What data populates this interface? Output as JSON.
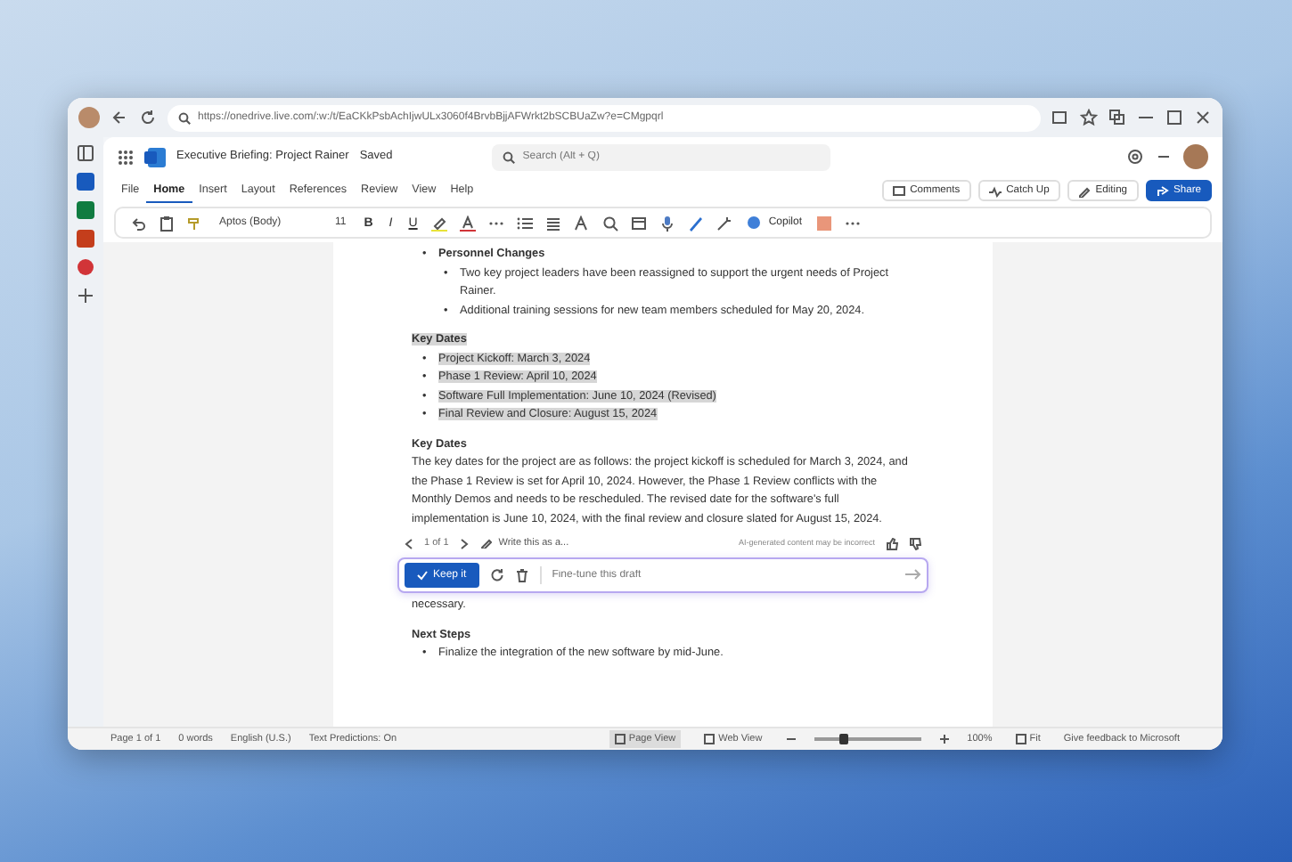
{
  "browser": {
    "url": "https://onedrive.live.com/:w:/t/EaCKkPsbAchIjwULx3060f4BrvbBjjAFWrkt2bSCBUaZw?e=CMgpqrl"
  },
  "app": {
    "title": "Executive Briefing: Project Rainer",
    "save_status": "Saved",
    "search": {
      "placeholder": "Search (Alt + Q)"
    }
  },
  "menu_tabs": [
    {
      "label": "File",
      "selected": false
    },
    {
      "label": "Home",
      "selected": true
    },
    {
      "label": "Insert",
      "selected": false
    },
    {
      "label": "Layout",
      "selected": false
    },
    {
      "label": "References",
      "selected": false
    },
    {
      "label": "Review",
      "selected": false
    },
    {
      "label": "View",
      "selected": false
    },
    {
      "label": "Help",
      "selected": false
    }
  ],
  "ribbon_actions": [
    {
      "label": "Comments",
      "kind": "comments"
    },
    {
      "label": "Catch Up",
      "kind": "catchup"
    },
    {
      "label": "Editing",
      "kind": "editing"
    },
    {
      "label": "Share",
      "kind": "share"
    }
  ],
  "toolbar": {
    "font": "Aptos (Body)",
    "size": "11",
    "bold": "B",
    "italic": "I",
    "underline": "U",
    "copilot": "Copilot"
  },
  "document": [
    {
      "kind": "list",
      "highlighted": false,
      "items": [
        {
          "marker": "•",
          "text": "Personnel Changes",
          "children": [
            {
              "marker": "•",
              "text": "Two key project leaders have been reassigned to support the urgent needs of Project Rainer."
            },
            {
              "marker": "•",
              "text": "Additional training sessions for new team members scheduled for May 20, 2024."
            }
          ]
        }
      ]
    },
    {
      "kind": "heading",
      "highlighted": true,
      "text": "Key Dates"
    },
    {
      "kind": "list",
      "highlighted": true,
      "items": [
        {
          "marker": "•",
          "text": "Project Kickoff: March 3, 2024"
        },
        {
          "marker": "•",
          "text": "Phase 1 Review: April 10, 2024"
        },
        {
          "marker": "•",
          "text": "Software Full Implementation: June 10, 2024 (Revised)"
        },
        {
          "marker": "•",
          "text": "Final Review and Closure: August 15, 2024"
        }
      ]
    },
    {
      "kind": "heading",
      "highlighted": false,
      "text": "Key Dates"
    },
    {
      "kind": "paragraph",
      "highlighted": false,
      "text": "The key dates for the project are as follows: the project kickoff is scheduled for March 3, 2024, and the Phase 1 Review is set for April 10, 2024. However, the Phase 1 Review conflicts with the Monthly Demos and needs to be rescheduled. The revised date for the software's full implementation is June 10, 2024, with the final review and closure slated for August 15, 2024."
    },
    {
      "kind": "copilot",
      "pager": "1 of 1",
      "prompt": "Write this as a...",
      "disclaimer": "AI-generated content may be incorrect",
      "keep": "Keep it",
      "input": {
        "placeholder": "Fine-tune this draft"
      }
    },
    {
      "kind": "paragraph",
      "highlighted": false,
      "text": "necessary."
    },
    {
      "kind": "heading",
      "highlighted": false,
      "text": "Next Steps"
    },
    {
      "kind": "list",
      "highlighted": false,
      "items": [
        {
          "marker": "•",
          "text": "Finalize the integration of the new software by mid-June."
        }
      ]
    }
  ],
  "status_bar": {
    "items": [
      "Page 1 of 1",
      "0 words",
      "English (U.S.)",
      "Text Predictions: On"
    ],
    "views": [
      {
        "label": "Page View",
        "selected": true
      },
      {
        "label": "Web View",
        "selected": false
      }
    ],
    "zoom": {
      "level": 0.28,
      "reading": "100%"
    },
    "fit": "Fit",
    "feedback": "Give feedback to Microsoft"
  }
}
